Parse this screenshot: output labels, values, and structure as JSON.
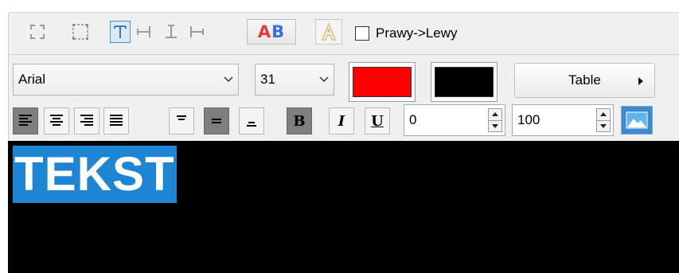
{
  "toolbar": {
    "icons": [
      "fit-icon",
      "select-area-icon",
      "text-top-icon",
      "text-right-icon",
      "text-bottom-icon",
      "text-left-icon"
    ],
    "ab_label_a": "A",
    "ab_label_b": "B",
    "outline_label": "A",
    "rtl_checked": false,
    "rtl_label": "Prawy->Lewy"
  },
  "font": {
    "family": "Arial",
    "size": "31",
    "fg_color": "#ff0000",
    "bg_color": "#000000",
    "table_label": "Table"
  },
  "format": {
    "align_buttons": [
      "align-left",
      "align-center",
      "align-right",
      "justify"
    ],
    "align_active": "align-left",
    "valign_active": "middle",
    "bold_label": "B",
    "italic_label": "I",
    "underline_label": "U",
    "spin1_value": "0",
    "spin2_value": "100"
  },
  "canvas": {
    "text": "TEKST",
    "highlight_color": "#1e84d4"
  }
}
